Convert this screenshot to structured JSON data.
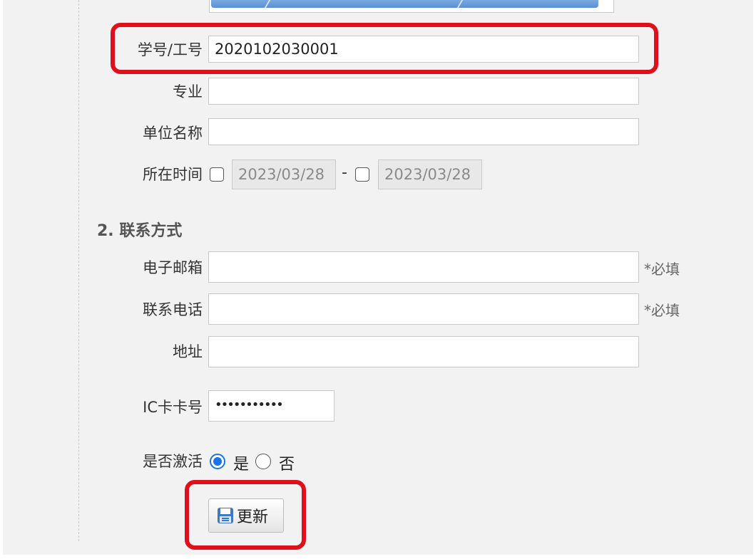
{
  "fields": {
    "student_id": {
      "label": "学号/工号",
      "value": "2020102030001"
    },
    "major": {
      "label": "专业",
      "value": ""
    },
    "unit_name": {
      "label": "单位名称",
      "value": ""
    },
    "period": {
      "label": "所在时间",
      "start": "2023/03/28",
      "end": "2023/03/28",
      "separator": "-"
    }
  },
  "contact": {
    "section_title": "2. 联系方式",
    "email": {
      "label": "电子邮箱",
      "value": "",
      "required": "*必填"
    },
    "phone": {
      "label": "联系电话",
      "value": "",
      "required": "*必填"
    },
    "address": {
      "label": "地址",
      "value": ""
    }
  },
  "ic_card": {
    "label": "IC卡卡号",
    "value": "•••••••••••"
  },
  "activation": {
    "label": "是否激活",
    "yes": "是",
    "no": "否",
    "selected": "是"
  },
  "actions": {
    "update_label": "更新"
  },
  "colors": {
    "highlight": "#e0101a",
    "radio_selected": "#1a73e8"
  }
}
